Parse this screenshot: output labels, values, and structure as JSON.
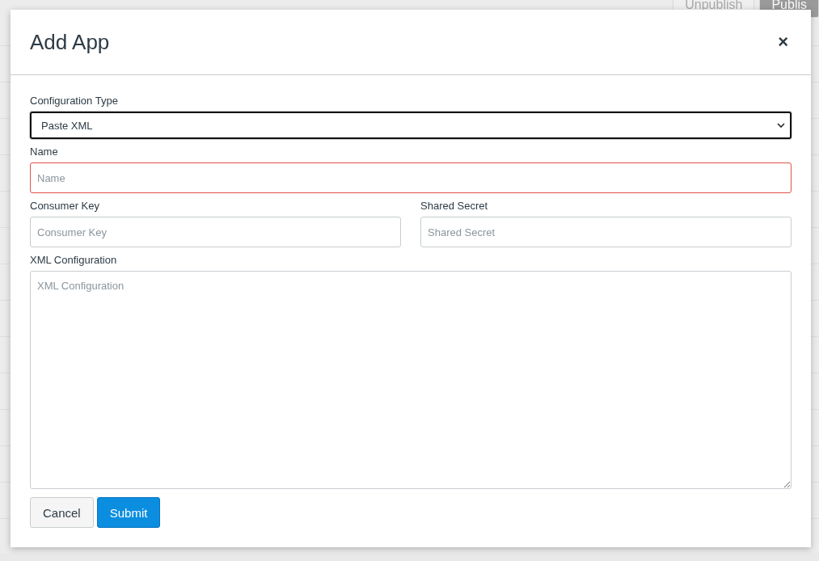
{
  "background": {
    "buttons": [
      {
        "label": "Unpublish",
        "kind": "unpublish"
      },
      {
        "label": "Publis",
        "kind": "publish"
      }
    ]
  },
  "dialog": {
    "title": "Add App",
    "close": "×",
    "configuration_type": {
      "label": "Configuration Type",
      "value": "Paste XML",
      "focused": true
    },
    "name": {
      "label": "Name",
      "placeholder": "Name",
      "invalid": true
    },
    "consumer_key": {
      "label": "Consumer Key",
      "placeholder": "Consumer Key"
    },
    "shared_secret": {
      "label": "Shared Secret",
      "placeholder": "Shared Secret"
    },
    "xml_configuration": {
      "label": "XML Configuration",
      "placeholder": "XML Configuration"
    },
    "buttons": [
      {
        "label": "Cancel",
        "kind": "secondary"
      },
      {
        "label": "Submit",
        "kind": "primary"
      }
    ]
  }
}
